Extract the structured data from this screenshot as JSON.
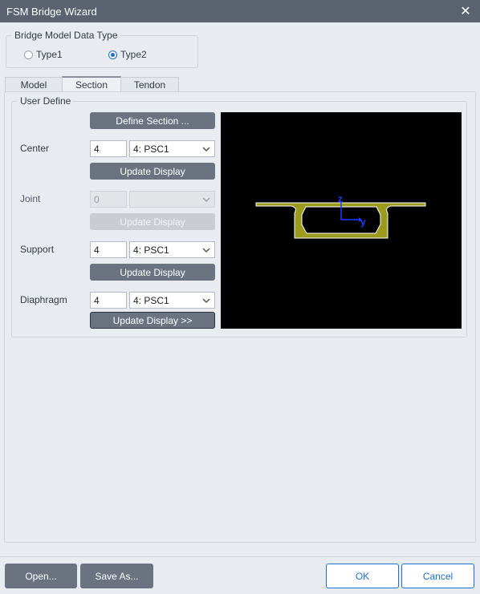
{
  "window": {
    "title": "FSM Bridge Wizard",
    "close_icon": "close-icon"
  },
  "model_data_type": {
    "legend": "Bridge Model Data Type",
    "options": [
      {
        "label": "Type1",
        "selected": false
      },
      {
        "label": "Type2",
        "selected": true
      }
    ]
  },
  "tabs": [
    {
      "label": "Model",
      "active": false
    },
    {
      "label": "Section",
      "active": true
    },
    {
      "label": "Tendon",
      "active": false
    }
  ],
  "user_define": {
    "legend": "User Define",
    "define_section_label": "Define Section ...",
    "rows": [
      {
        "label": "Center",
        "value": "4",
        "section": "4: PSC1",
        "button": "Update Display",
        "enabled": true
      },
      {
        "label": "Joint",
        "value": "0",
        "section": "",
        "button": "Update Display",
        "enabled": false
      },
      {
        "label": "Support",
        "value": "4",
        "section": "4: PSC1",
        "button": "Update Display",
        "enabled": true
      },
      {
        "label": "Diaphragm",
        "value": "4",
        "section": "4: PSC1",
        "button": "Update Display >>",
        "enabled": true
      }
    ]
  },
  "viewer": {
    "axis_z": "z",
    "axis_y": "y",
    "section_color": "#9a9a1c",
    "outline_color": "#ffffff",
    "axis_color": "#1a3cff",
    "background": "#000000"
  },
  "footer": {
    "open_label": "Open...",
    "save_as_label": "Save As...",
    "ok_label": "OK",
    "cancel_label": "Cancel"
  }
}
